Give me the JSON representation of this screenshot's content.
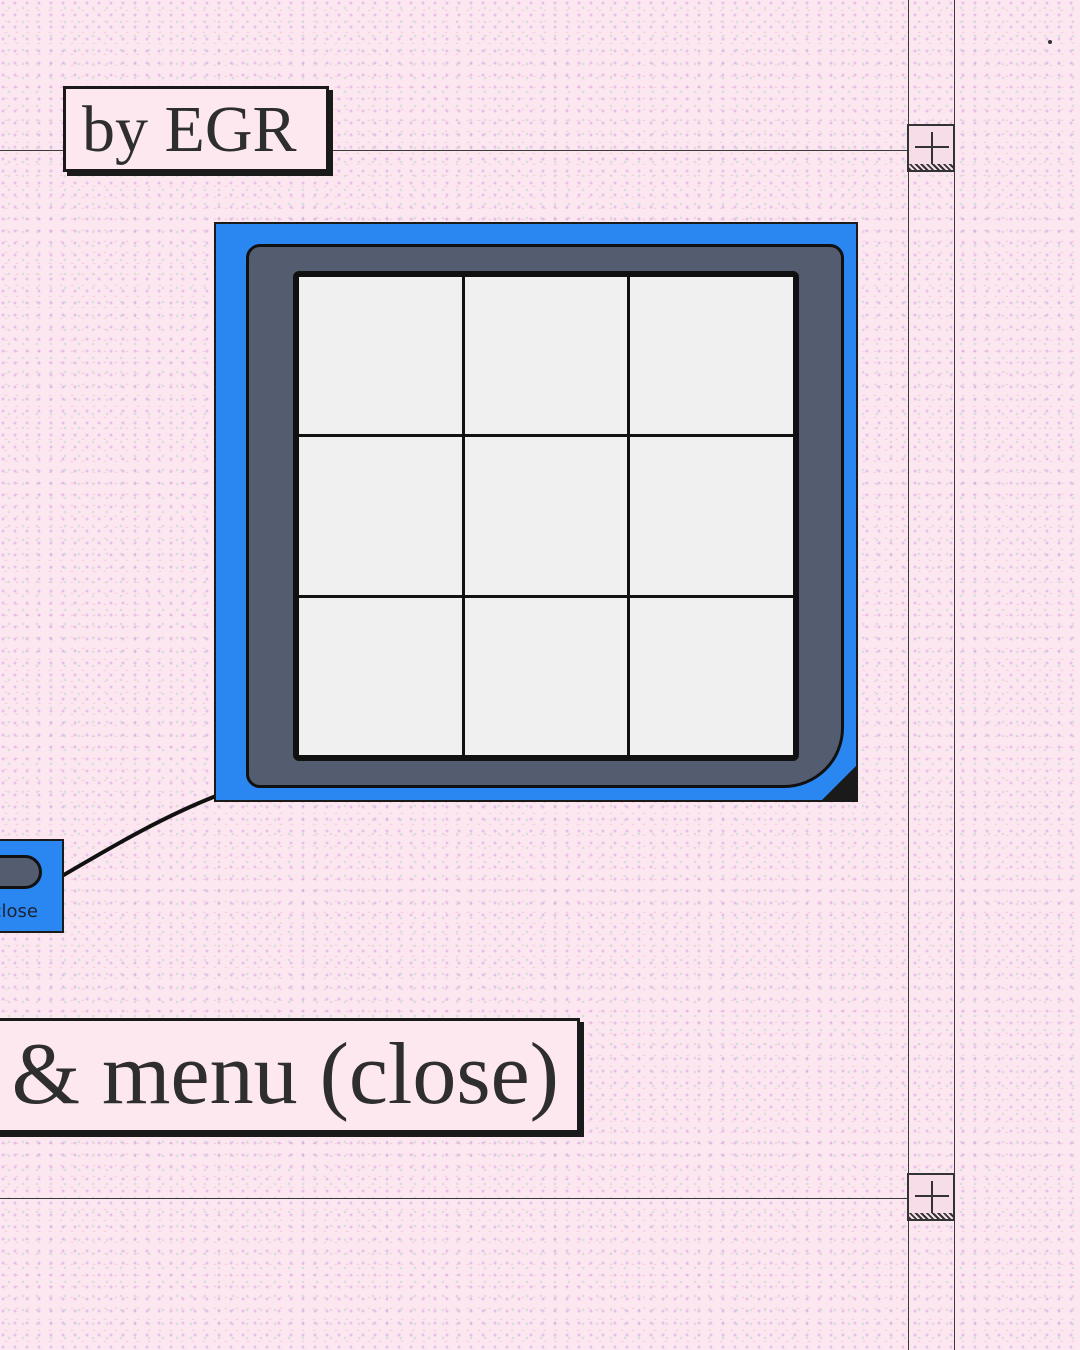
{
  "top_tag": {
    "text": "by EGR"
  },
  "bottom_tag": {
    "text": "& menu (close)"
  },
  "mini_button": {
    "label": "close"
  },
  "board": {
    "rows": 3,
    "cols": 3
  },
  "colors": {
    "background": "#fce6f0",
    "device_blue": "#2a87f1",
    "bezel_slate": "#545d6f",
    "cell": "#f0f0f0",
    "ink": "#1a1a1a"
  }
}
